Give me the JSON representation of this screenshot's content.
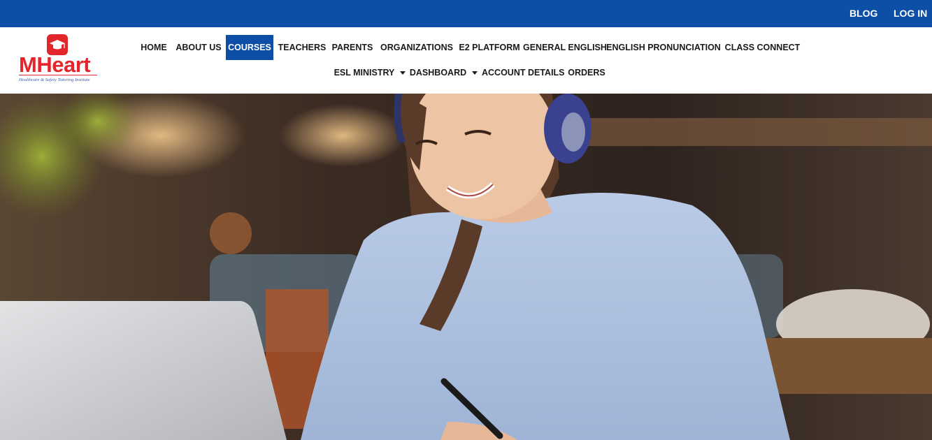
{
  "topbar": {
    "blog": "BLOG",
    "login": "LOG IN"
  },
  "logo": {
    "brand": "MHeart",
    "tagline": "Healthcare & Safety Tutoring Institute"
  },
  "nav": {
    "row1": [
      "HOME",
      "ABOUT US",
      "COURSES",
      "TEACHERS",
      "PARENTS",
      "ORGANIZATIONS",
      "E2 PLATFORM",
      "GENERAL ENGLISH",
      "ENGLISH PRONUNCIATION",
      "CLASS CONNECT"
    ],
    "row2": [
      "ESL MINISTRY",
      "DASHBOARD",
      "ACCOUNT DETAILS",
      "ORDERS"
    ],
    "active": "COURSES"
  },
  "colors": {
    "brand_blue": "#0d4ea6",
    "brand_red": "#e3262b"
  },
  "hero": {
    "icon": "hero-photo-student-with-headphones"
  }
}
